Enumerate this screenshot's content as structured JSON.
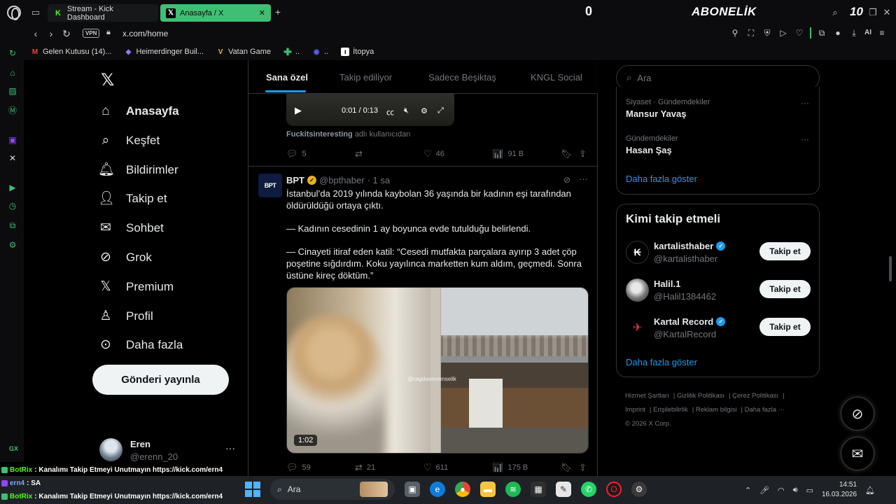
{
  "browser": {
    "tabs": [
      {
        "label": "Stream - Kick Dashboard"
      },
      {
        "label": "Anasayfa / X"
      }
    ],
    "url": "x.com/home",
    "vpn_label": "VPN",
    "ai_label": "AI",
    "overlay": {
      "counter": "0",
      "abonelik": "ABONELİK",
      "goal": "10"
    },
    "bookmarks": [
      {
        "label": "Gelen Kutusu (14)...",
        "icon": "gmail-icon"
      },
      {
        "label": "Heimerdinger Buil...",
        "icon": "lol-icon"
      },
      {
        "label": "Vatan Game",
        "icon": "vatan-icon"
      },
      {
        "label": "..",
        "icon": "plus-icon"
      },
      {
        "label": "..",
        "icon": "discord-icon"
      },
      {
        "label": "İtopya",
        "icon": "itopya-icon"
      }
    ],
    "sidebar_gx_label": "GX"
  },
  "nav": {
    "items": [
      {
        "label": "Anasayfa",
        "icon": "home-icon"
      },
      {
        "label": "Keşfet",
        "icon": "search-icon"
      },
      {
        "label": "Bildirimler",
        "icon": "bell-icon"
      },
      {
        "label": "Takip et",
        "icon": "follow-icon"
      },
      {
        "label": "Sohbet",
        "icon": "mail-icon"
      },
      {
        "label": "Grok",
        "icon": "grok-icon"
      },
      {
        "label": "Premium",
        "icon": "x-icon"
      },
      {
        "label": "Profil",
        "icon": "profile-icon"
      },
      {
        "label": "Daha fazla",
        "icon": "more-icon"
      }
    ],
    "post_button": "Gönderi yayınla",
    "account": {
      "name": "Eren",
      "handle": "@erenn_20"
    }
  },
  "timeline": {
    "tabs": [
      "Sana özel",
      "Takip ediliyor",
      "Sadece Beşiktaş",
      "KNGL Social"
    ],
    "prev_tweet": {
      "video_time": "0:01 / 0:13",
      "source_user": "Fuckitsinteresting",
      "source_suffix": "adlı kullanıcıdan",
      "replies": "5",
      "likes": "46",
      "views": "91 B"
    },
    "tweet": {
      "avatar_text": "BPT",
      "name": "BPT",
      "handle": "@bpthaber",
      "time": "· 1 sa",
      "paragraphs": [
        "İstanbul’da 2019 yılında kaybolan 36 yaşında bir kadının eşi tarafından öldürüldüğü ortaya çıktı.",
        "— Kadının cesedinin 1 ay boyunca evde tutulduğu belirlendi.",
        "— Cinayeti itiraf eden katil: “Cesedi mutfakta parçalara ayırıp 3 adet çöp poşetine sığdırdım. Koku yayılınca marketten kum aldım, geçmedi. Sonra üstüne kireç döktüm.”"
      ],
      "watermark": "@cagdasevrenselik",
      "duration": "1:02",
      "replies": "59",
      "reposts": "21",
      "likes": "611",
      "views": "175 B"
    }
  },
  "sidebar_right": {
    "search_placeholder": "Ara",
    "trends": [
      {
        "category": "Siyaset · Gündemdekiler",
        "title": "Mansur Yavaş"
      },
      {
        "category": "Gündemdekiler",
        "title": "Hasan Şaş"
      }
    ],
    "show_more": "Daha fazla göster",
    "who_title": "Kimi takip etmeli",
    "who": [
      {
        "name": "kartalisthaber",
        "handle": "@kartalisthaber",
        "verified": true
      },
      {
        "name": "Halil.1",
        "handle": "@Halil1384462",
        "verified": false
      },
      {
        "name": "Kartal Record",
        "handle": "@KartalRecord",
        "verified": true
      }
    ],
    "follow_label": "Takip et",
    "who_show_more": "Daha fazla göster",
    "footer": [
      "Hizmet Şartları",
      "Gizlilik Politikası",
      "Çerez Politikası",
      "Imprint",
      "Erişilebilirlik",
      "Reklam bilgisi",
      "Daha fazla ···",
      "© 2026 X Corp."
    ]
  },
  "chat": [
    {
      "user": "BotRix",
      "text": ": Kanalımı Takip Etmeyi Unutmayın https://kick.com/ern4"
    },
    {
      "user": "ern4",
      "text": ": SA"
    },
    {
      "user": "BotRix",
      "text": ": Kanalımı Takip Etmeyi Unutmayın https://kick.com/ern4"
    }
  ],
  "taskbar": {
    "search_label": "Ara",
    "time": "14:51",
    "date": "16.03.2026"
  },
  "colors": {
    "accent": "#1d9bf0",
    "gx_green": "#3fbf74",
    "bg": "#000000"
  }
}
